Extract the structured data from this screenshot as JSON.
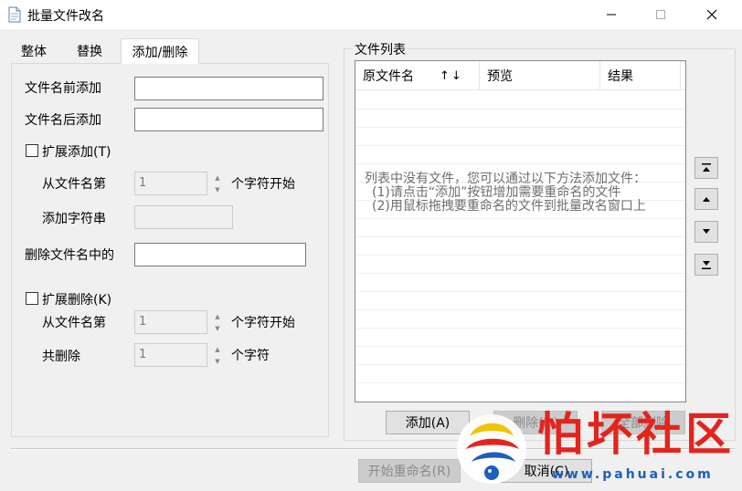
{
  "window": {
    "title": "批量文件改名",
    "controls": {
      "minimize": "—",
      "maximize": "☐",
      "close": "✕"
    }
  },
  "tabs": [
    "整体",
    "替换",
    "添加/删除"
  ],
  "active_tab": "添加/删除",
  "add_section": {
    "prefix_label": "文件名前添加",
    "prefix_value": "",
    "suffix_label": "文件名后添加",
    "suffix_value": "",
    "extended_add_label": "扩展添加(T)",
    "extended_add_checked": false,
    "from_pos_label": "从文件名第",
    "from_pos_value": "1",
    "from_pos_suffix": "个字符开始",
    "add_string_label": "添加字符串",
    "add_string_value": ""
  },
  "delete_section": {
    "delete_label": "删除文件名中的",
    "delete_value": "",
    "extended_delete_label": "扩展删除(K)",
    "extended_delete_checked": false,
    "from_pos_label": "从文件名第",
    "from_pos_value": "1",
    "from_pos_suffix": "个字符开始",
    "count_label": "共删除",
    "count_value": "1",
    "count_suffix": "个字符"
  },
  "file_list": {
    "group_title": "文件列表",
    "columns": [
      "原文件名",
      "预览",
      "结果"
    ],
    "sort_glyph": "↑↓",
    "empty_lines": [
      "列表中没有文件，您可以通过以下方法添加文件：",
      "(1)请点击“添加”按钮增加需要重命名的文件",
      "(2)用鼠标拖拽要重命名的文件到批量改名窗口上"
    ],
    "side_buttons": [
      "move-top",
      "move-up",
      "move-down",
      "move-bottom"
    ]
  },
  "buttons": {
    "add": "添加(A)",
    "remove": "删除(D)",
    "clear": "全部删除",
    "start": "开始重命名(R)",
    "cancel": "取消(C)"
  },
  "watermark": {
    "text": "怕坏社区",
    "url": "www.pahuai.com"
  }
}
